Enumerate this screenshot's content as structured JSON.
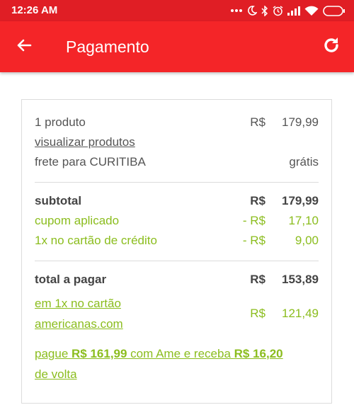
{
  "status_bar": {
    "time": "12:26 AM"
  },
  "app_bar": {
    "title": "Pagamento",
    "back_icon": "arrow-left-icon",
    "refresh_icon": "refresh-icon"
  },
  "summary": {
    "products": {
      "label": "1 produto",
      "currency": "R$",
      "value": "179,99"
    },
    "view_products_link": "visualizar produtos",
    "shipping": {
      "label": "frete para CURITIBA",
      "value": "grátis"
    },
    "subtotal": {
      "label": "subtotal",
      "currency": "R$",
      "value": "179,99"
    },
    "coupon": {
      "label": "cupom aplicado",
      "currency": "- R$",
      "value": "17,10"
    },
    "card_discount": {
      "label": "1x no cartão de crédito",
      "currency": "- R$",
      "value": "9,00"
    },
    "total": {
      "label": "total a pagar",
      "currency": "R$",
      "value": "153,89"
    },
    "installment": {
      "label_line1": "em 1x no cartão",
      "label_line2": "americanas.com",
      "currency": "R$",
      "value": "121,49"
    },
    "ame_offer": {
      "part1": "pague ",
      "amount1": "R$ 161,99",
      "part2": " com Ame e receba ",
      "amount2": "R$ 16,20",
      "part3": "de volta"
    }
  },
  "colors": {
    "status_bar": "#e01e25",
    "app_bar": "#f42528",
    "green_accent": "#8bbd1e"
  }
}
